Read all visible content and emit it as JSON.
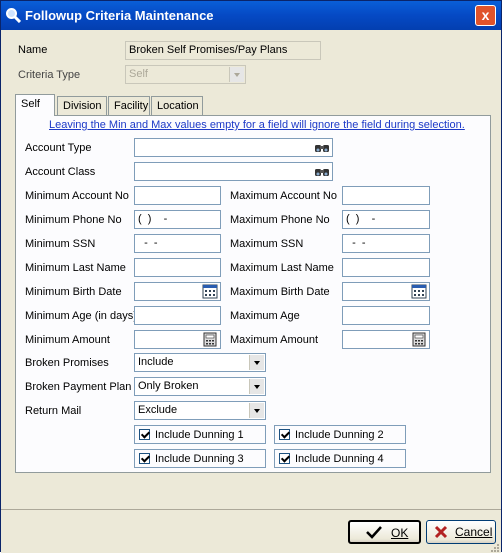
{
  "window": {
    "title": "Followup Criteria Maintenance",
    "close_glyph": "x"
  },
  "header": {
    "name_label": "Name",
    "name_value": "Broken Self Promises/Pay Plans",
    "criteria_type_label": "Criteria Type",
    "criteria_type_value": "Self"
  },
  "tabs": [
    {
      "label": "Self",
      "active": true
    },
    {
      "label": "Division",
      "active": false
    },
    {
      "label": "Facility",
      "active": false
    },
    {
      "label": "Location",
      "active": false
    }
  ],
  "notice": "Leaving the Min and Max values empty for a field will ignore the field during selection.",
  "fields": {
    "account_type_label": "Account Type",
    "account_class_label": "Account Class",
    "min_account_no_label": "Minimum Account No",
    "max_account_no_label": "Maximum Account No",
    "min_phone_label": "Minimum Phone No",
    "min_phone_value": "(  )    -",
    "max_phone_label": "Maximum Phone No",
    "max_phone_value": "(  )    -",
    "min_ssn_label": "Minimum SSN",
    "min_ssn_value": "  -  -",
    "max_ssn_label": "Maximum SSN",
    "max_ssn_value": "  -  -",
    "min_last_name_label": "Minimum Last Name",
    "max_last_name_label": "Maximum Last Name",
    "min_birth_label": "Minimum Birth Date",
    "max_birth_label": "Maximum Birth Date",
    "min_age_label": "Minimum Age (in days)",
    "max_age_label": "Maximum Age",
    "min_amount_label": "Minimum Amount",
    "max_amount_label": "Maximum Amount",
    "broken_promises_label": "Broken Promises",
    "broken_promises_value": "Include",
    "broken_payment_label": "Broken Payment Plan",
    "broken_payment_value": "Only Broken",
    "return_mail_label": "Return Mail",
    "return_mail_value": "Exclude"
  },
  "checkboxes": [
    {
      "label": "Include Dunning 1",
      "checked": true
    },
    {
      "label": "Include Dunning 2",
      "checked": true
    },
    {
      "label": "Include Dunning 3",
      "checked": true
    },
    {
      "label": "Include Dunning 4",
      "checked": true
    }
  ],
  "buttons": {
    "ok_label": "OK",
    "cancel_label": "Cancel"
  },
  "colors": {
    "title_bar": "#0549c4",
    "link": "#1c39c7",
    "face": "#ece9d8",
    "close": "#e0532b"
  }
}
